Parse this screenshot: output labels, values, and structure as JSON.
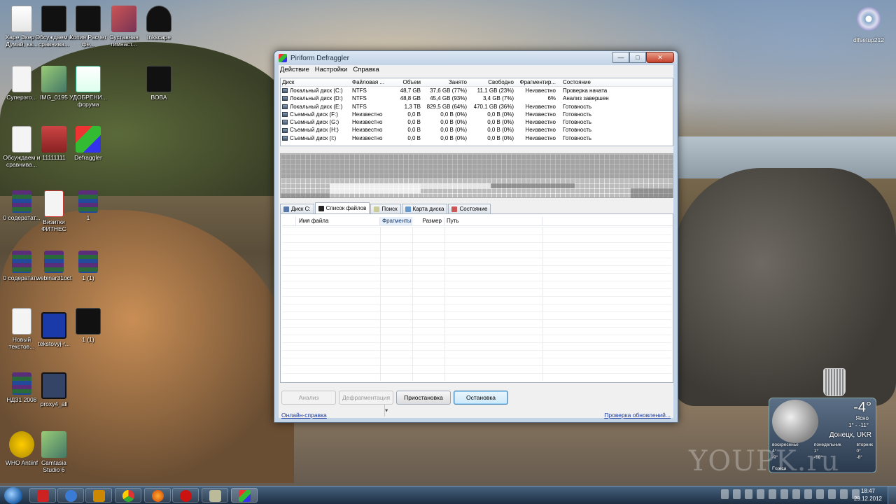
{
  "desktop": {
    "icons": [
      {
        "label": "Харе Экер - Думай, ка..."
      },
      {
        "label": "Обсуждаем и сравнива..."
      },
      {
        "label": "Копия Расчет фе..."
      },
      {
        "label": "Суставная гимнаст..."
      },
      {
        "label": "Inkscape"
      },
      {
        "label": "Суперэго..."
      },
      {
        "label": "IMG_0195"
      },
      {
        "label": "УДОБРЕНИ... форума"
      },
      {
        "label": "ВОВА"
      },
      {
        "label": "Обсуждаем и сравнива..."
      },
      {
        "label": "11111111"
      },
      {
        "label": "Defraggler"
      },
      {
        "label": "0 содератат..."
      },
      {
        "label": "Визитки ФИТНЕС"
      },
      {
        "label": "1"
      },
      {
        "label": "0 содератат..."
      },
      {
        "label": "webinar31oct"
      },
      {
        "label": "1 (1)"
      },
      {
        "label": "Новый текстов..."
      },
      {
        "label": "tekstovyj-r..."
      },
      {
        "label": "1 (1)"
      },
      {
        "label": "НДЗ1 2008"
      },
      {
        "label": "proxy4_all"
      },
      {
        "label": "WHO Antiinf"
      },
      {
        "label": "Camtasia Studio 6"
      }
    ],
    "right_icon_label": "dlfsetup212"
  },
  "window": {
    "title": "Piriform Defraggler",
    "controls": {
      "minimize": "—",
      "maximize": "□",
      "close": "✕"
    },
    "menu": [
      "Действие",
      "Настройки",
      "Справка"
    ],
    "drive_columns": [
      "Диск",
      "Файловая ...",
      "Объем",
      "Занято",
      "Свободно",
      "Фрагментир...",
      "Состояние"
    ],
    "drives": [
      {
        "disk": "Локальный диск (C:)",
        "fs": "NTFS",
        "size": "48,7 GB",
        "used": "37,6 GB (77%)",
        "free": "11,1 GB (23%)",
        "frag": "Неизвестно",
        "status": "Проверка начата"
      },
      {
        "disk": "Локальный диск (D:)",
        "fs": "NTFS",
        "size": "48,8 GB",
        "used": "45,4 GB (93%)",
        "free": "3,4 GB (7%)",
        "frag": "6%",
        "status": "Анализ завершен"
      },
      {
        "disk": "Локальный диск (E:)",
        "fs": "NTFS",
        "size": "1,3 TB",
        "used": "829,5 GB (64%)",
        "free": "470,1 GB (36%)",
        "frag": "Неизвестно",
        "status": "Готовность"
      },
      {
        "disk": "Съемный диск (F:)",
        "fs": "Неизвестно",
        "size": "0,0 B",
        "used": "0,0 B (0%)",
        "free": "0,0 B (0%)",
        "frag": "Неизвестно",
        "status": "Готовность"
      },
      {
        "disk": "Съемный диск (G:)",
        "fs": "Неизвестно",
        "size": "0,0 B",
        "used": "0,0 B (0%)",
        "free": "0,0 B (0%)",
        "frag": "Неизвестно",
        "status": "Готовность"
      },
      {
        "disk": "Съемный диск (H:)",
        "fs": "Неизвестно",
        "size": "0,0 B",
        "used": "0,0 B (0%)",
        "free": "0,0 B (0%)",
        "frag": "Неизвестно",
        "status": "Готовность"
      },
      {
        "disk": "Съемный диск (I:)",
        "fs": "Неизвестно",
        "size": "0,0 B",
        "used": "0,0 B (0%)",
        "free": "0,0 B (0%)",
        "frag": "Неизвестно",
        "status": "Готовность"
      }
    ],
    "tabs": [
      "Диск С:",
      "Список файлов",
      "Поиск",
      "Карта диска",
      "Состояние"
    ],
    "file_columns": [
      "Имя файла",
      "Фрагменты",
      "Размер",
      "Путь"
    ],
    "buttons": {
      "analyze": "Анализ",
      "defrag": "Дефрагментация",
      "pause": "Приостановка",
      "stop": "Остановка"
    },
    "links": {
      "help": "Онлайн-справка",
      "updates": "Проверка обновлений..."
    }
  },
  "weather": {
    "temp": "-4°",
    "condition": "Ясно",
    "range": "1° - -11°",
    "city": "Донецк, UKR",
    "days": [
      {
        "name": "воскресенье",
        "hi": "4°",
        "lo": "-9°"
      },
      {
        "name": "понедельник",
        "hi": "1°",
        "lo": "-10°"
      },
      {
        "name": "вторник",
        "hi": "0°",
        "lo": "-8°"
      }
    ],
    "source": "Foreca"
  },
  "watermark": "YOUPK.ru",
  "taskbar": {
    "time": "18:47",
    "date": "29.12.2012"
  },
  "colors": {
    "accent": "#3c7fb1",
    "link": "#1a3aa0",
    "titlebar": "#c3d4e6"
  }
}
